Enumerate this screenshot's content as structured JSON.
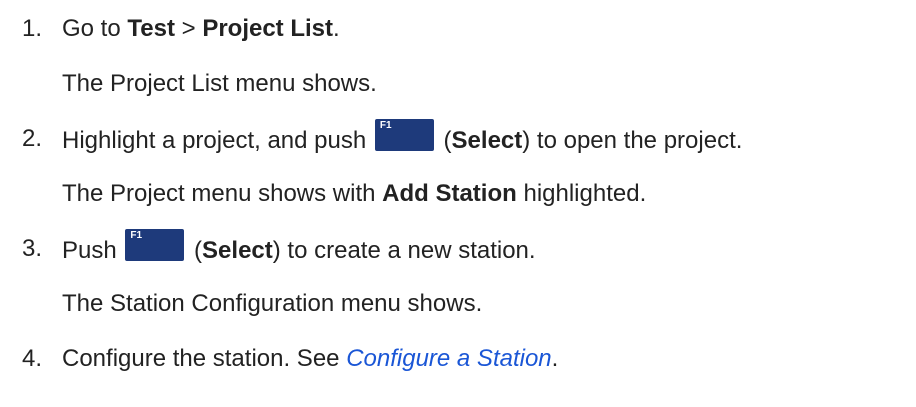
{
  "steps": [
    {
      "number": "1.",
      "instruction": {
        "p1": "Go to ",
        "b1": "Test",
        "p2": " > ",
        "b2": "Project List",
        "p3": "."
      },
      "result": "The Project List menu shows."
    },
    {
      "number": "2.",
      "instruction": {
        "p1": "Highlight a project, and push ",
        "key_label": "F1",
        "p2": " (",
        "b1": "Select",
        "p3": ") to open the project."
      },
      "result": {
        "p1": "The Project menu shows with ",
        "b1": "Add Station",
        "p2": " highlighted."
      }
    },
    {
      "number": "3.",
      "instruction": {
        "p1": "Push ",
        "key_label": "F1",
        "p2": " (",
        "b1": "Select",
        "p3": ") to create a new station."
      },
      "result": "The Station Configuration menu shows."
    },
    {
      "number": "4.",
      "instruction": {
        "p1": "Configure the station. See ",
        "link": "Configure a Station",
        "p2": "."
      }
    }
  ],
  "colors": {
    "text": "#222222",
    "key_background": "#1e3a7b",
    "key_text": "#ffffff",
    "link": "#1a56d6"
  }
}
